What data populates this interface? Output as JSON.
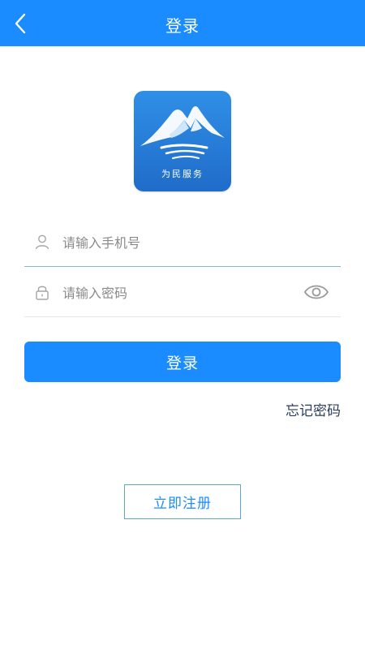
{
  "header": {
    "title": "登录",
    "back_icon": "chevron-left-icon"
  },
  "logo": {
    "text": "为民服务",
    "icon": "mountain-logo-icon"
  },
  "form": {
    "phone": {
      "placeholder": "请输入手机号",
      "value": "",
      "icon": "user-icon"
    },
    "password": {
      "placeholder": "请输入密码",
      "value": "",
      "icon": "lock-icon",
      "toggle_icon": "eye-icon"
    }
  },
  "actions": {
    "login_label": "登录",
    "forgot_label": "忘记密码",
    "register_label": "立即注册"
  },
  "colors": {
    "primary": "#1a8cff",
    "header_text": "#ffffff",
    "link_text": "#2a3e5a"
  }
}
